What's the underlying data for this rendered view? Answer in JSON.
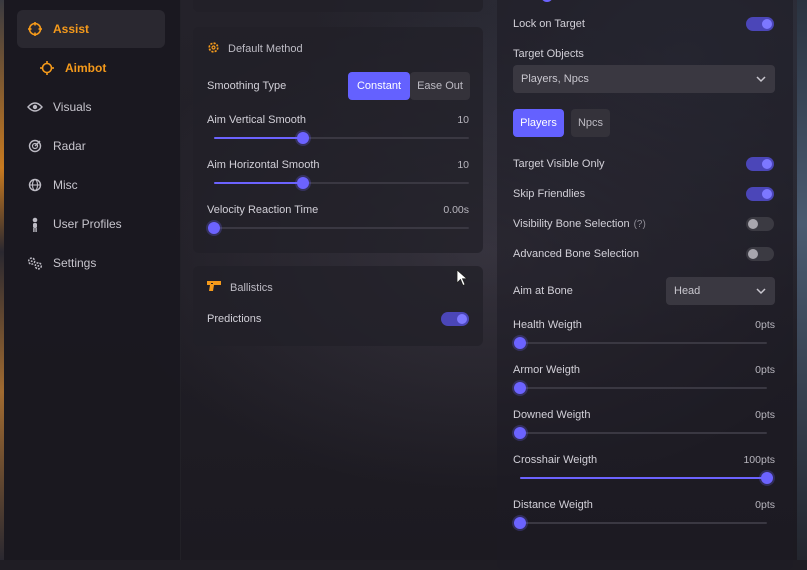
{
  "accent": "#6c63ff",
  "brand": "#f59a1b",
  "sidebar": {
    "items": [
      {
        "label": "Assist",
        "icon": "crosshair-icon"
      },
      {
        "label": "Aimbot",
        "icon": "target-icon"
      },
      {
        "label": "Visuals",
        "icon": "eye-icon"
      },
      {
        "label": "Radar",
        "icon": "radar-icon"
      },
      {
        "label": "Misc",
        "icon": "globe-icon"
      },
      {
        "label": "User Profiles",
        "icon": "person-icon"
      },
      {
        "label": "Settings",
        "icon": "gears-icon"
      }
    ]
  },
  "default_method": {
    "title": "Default Method",
    "smoothing_type_label": "Smoothing Type",
    "smoothing_options": [
      "Constant",
      "Ease Out"
    ],
    "smoothing_selected": "Constant",
    "sliders": [
      {
        "label": "Aim Vertical Smooth",
        "value": "10",
        "fraction": 0.35
      },
      {
        "label": "Aim Horizontal Smooth",
        "value": "10",
        "fraction": 0.35
      },
      {
        "label": "Velocity Reaction Time",
        "value": "0.00s",
        "fraction": 0.0
      }
    ]
  },
  "ballistics": {
    "title": "Ballistics",
    "predictions_label": "Predictions",
    "predictions_on": true
  },
  "right": {
    "lock_on_target": {
      "label": "Lock on Target",
      "on": true
    },
    "target_objects": {
      "label": "Target Objects",
      "value": "Players, Npcs"
    },
    "tabs": [
      "Players",
      "Npcs"
    ],
    "tab_selected": "Players",
    "toggles": [
      {
        "label": "Target Visible Only",
        "on": true,
        "help": ""
      },
      {
        "label": "Skip Friendlies",
        "on": true,
        "help": ""
      },
      {
        "label": "Visibility Bone Selection",
        "on": false,
        "help": "(?)"
      },
      {
        "label": "Advanced Bone Selection",
        "on": false,
        "help": ""
      }
    ],
    "aim_at_bone": {
      "label": "Aim at Bone",
      "value": "Head"
    },
    "weights": [
      {
        "label": "Health Weigth",
        "value": "0pts",
        "fraction": 0.0
      },
      {
        "label": "Armor Weigth",
        "value": "0pts",
        "fraction": 0.0
      },
      {
        "label": "Downed Weigth",
        "value": "0pts",
        "fraction": 0.0
      },
      {
        "label": "Crosshair Weigth",
        "value": "100pts",
        "fraction": 1.0
      },
      {
        "label": "Distance Weigth",
        "value": "0pts",
        "fraction": 0.0
      }
    ]
  }
}
